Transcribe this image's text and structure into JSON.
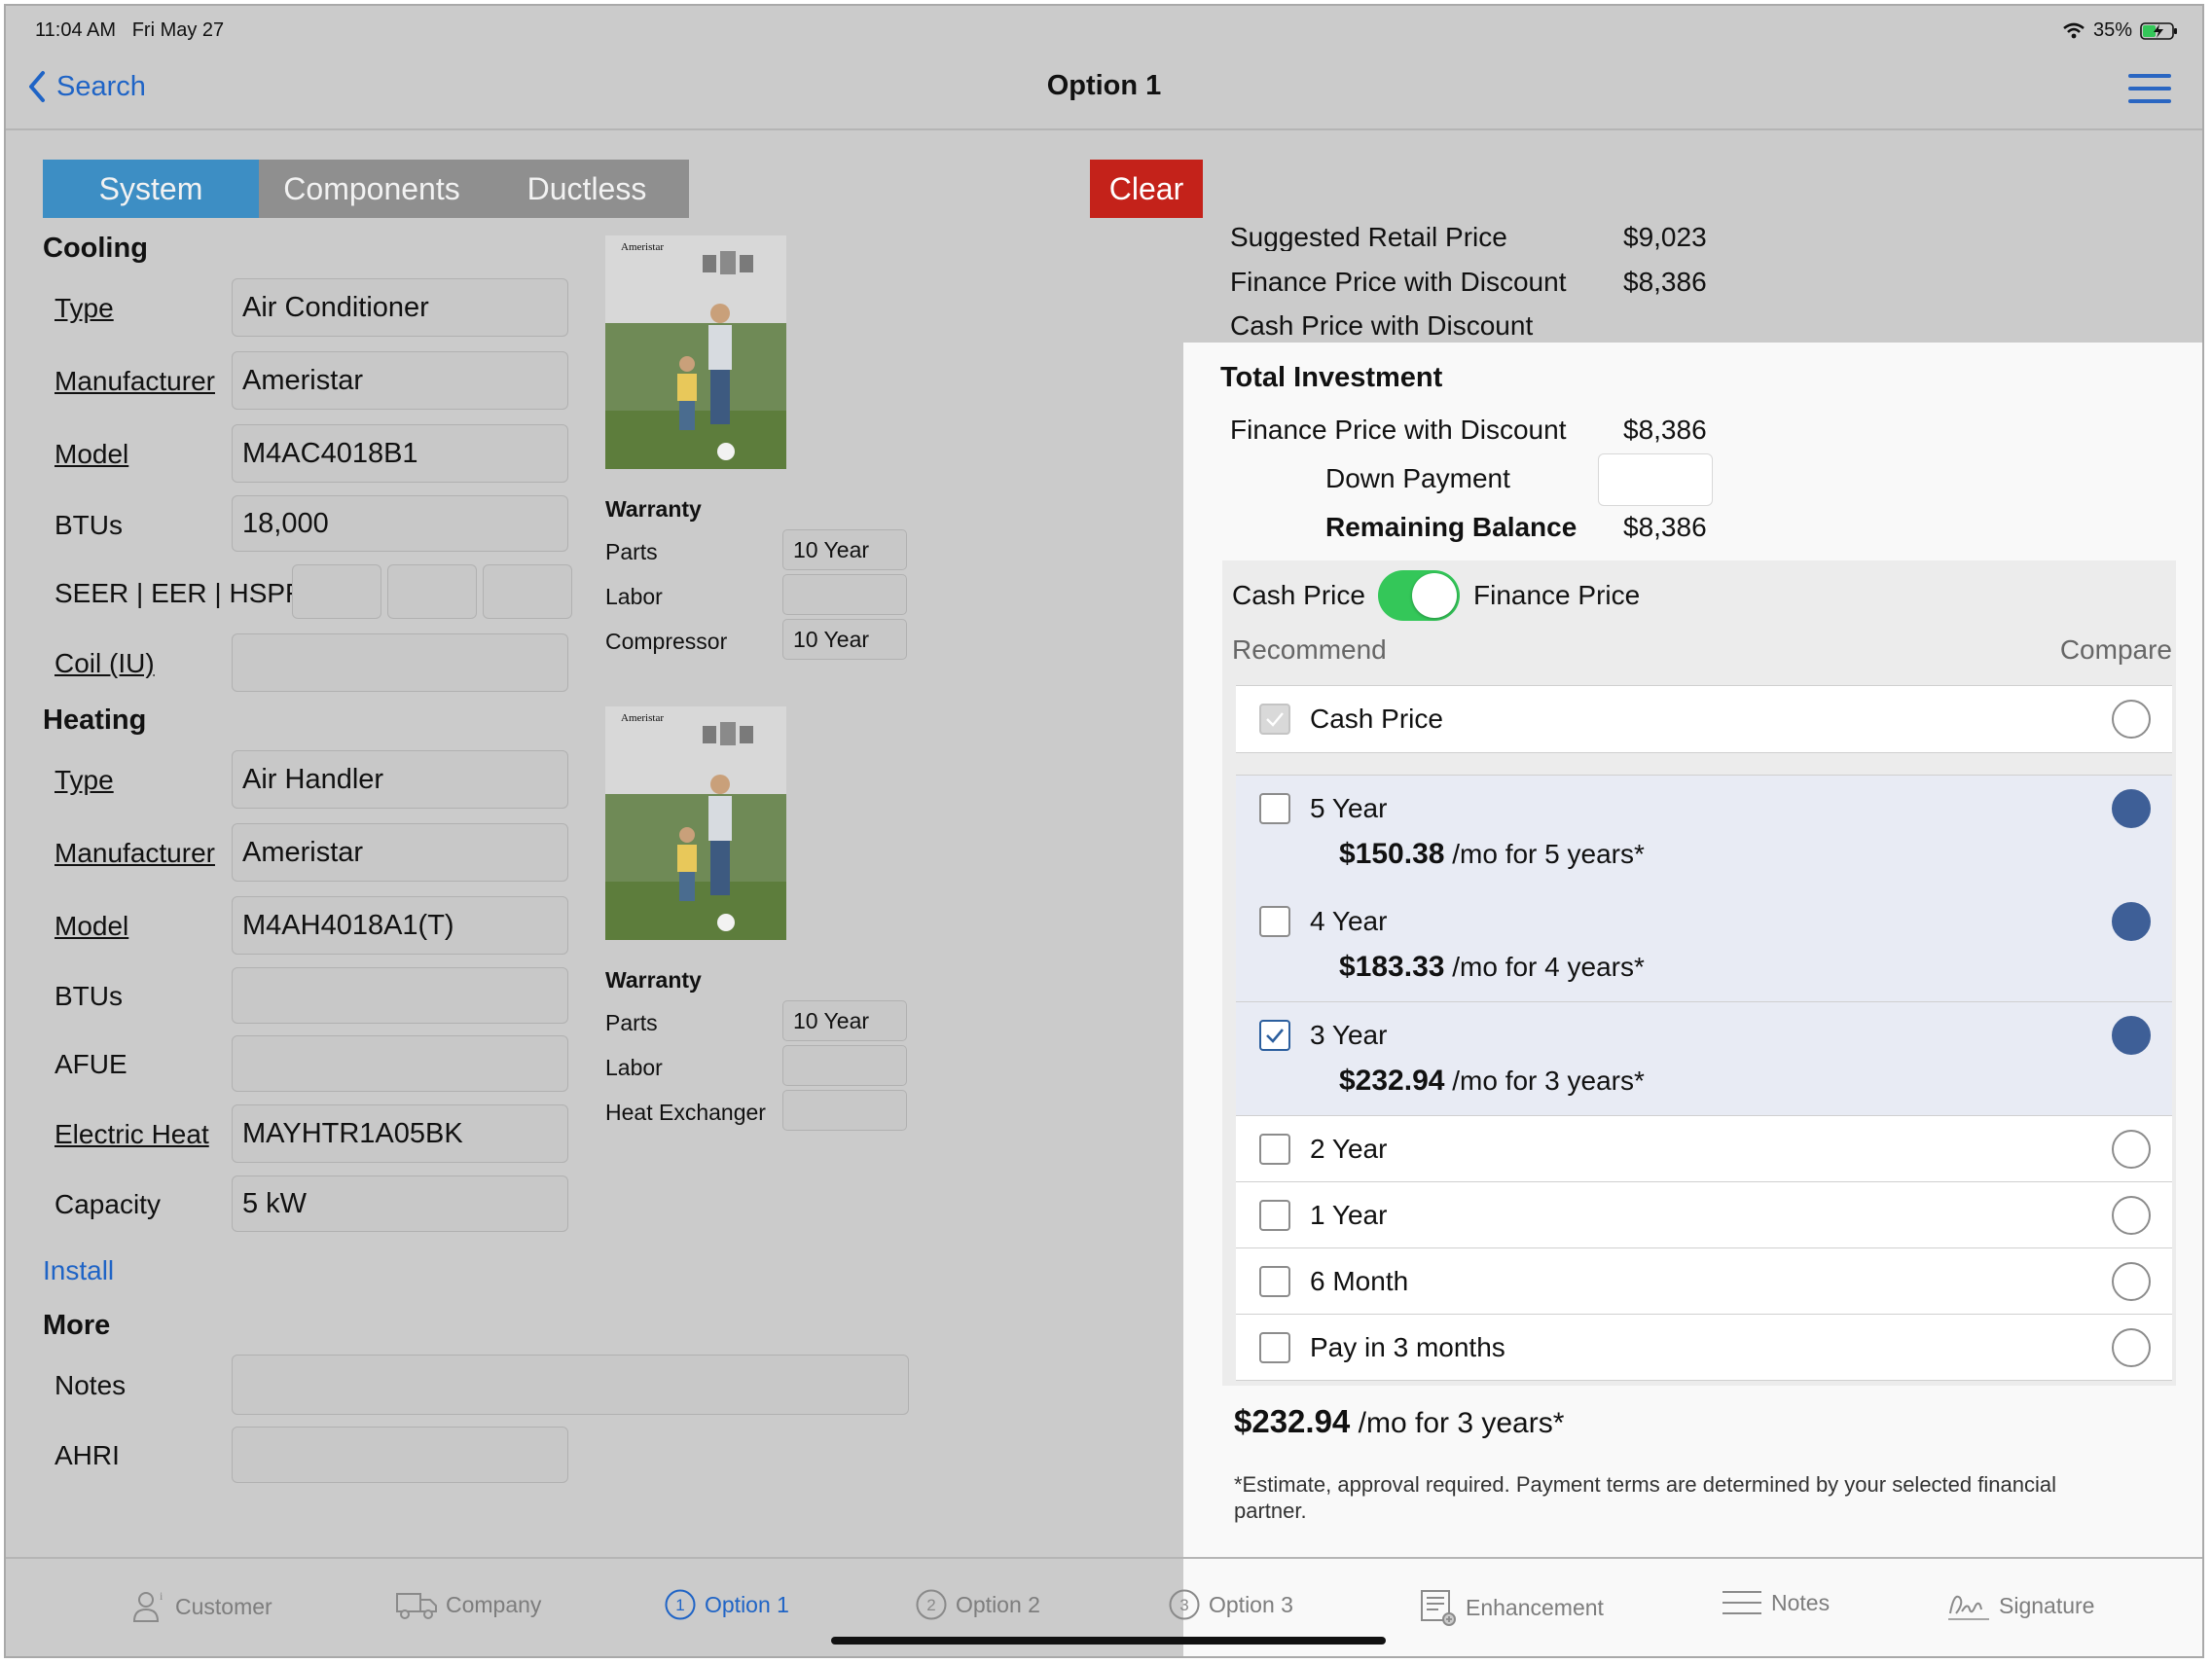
{
  "status_bar": {
    "time": "11:04 AM",
    "date": "Fri May 27",
    "battery": "35%"
  },
  "nav": {
    "back_label": "Search",
    "title": "Option 1"
  },
  "tabs": [
    "System",
    "Components",
    "Ductless"
  ],
  "clear_label": "Clear",
  "cooling": {
    "title": "Cooling",
    "type_label": "Type",
    "type_value": "Air Conditioner",
    "manufacturer_label": "Manufacturer",
    "manufacturer_value": "Ameristar",
    "model_label": "Model",
    "model_value": "M4AC4018B1",
    "btus_label": "BTUs",
    "btus_value": "18,000",
    "seer_label": "SEER | EER | HSPF",
    "coil_label": "Coil (IU)",
    "brochure_brand": "Ameristar",
    "warranty_title": "Warranty",
    "parts_label": "Parts",
    "parts_value": "10 Year",
    "labor_label": "Labor",
    "compressor_label": "Compressor",
    "compressor_value": "10 Year"
  },
  "heating": {
    "title": "Heating",
    "type_label": "Type",
    "type_value": "Air Handler",
    "manufacturer_label": "Manufacturer",
    "manufacturer_value": "Ameristar",
    "model_label": "Model",
    "model_value": "M4AH4018A1(T)",
    "btus_label": "BTUs",
    "afue_label": "AFUE",
    "electric_heat_label": "Electric Heat",
    "electric_heat_value": "MAYHTR1A05BK",
    "capacity_label": "Capacity",
    "capacity_value": "5 kW",
    "brochure_brand": "Ameristar",
    "warranty_title": "Warranty",
    "parts_label": "Parts",
    "parts_value": "10 Year",
    "labor_label": "Labor",
    "heat_exchanger_label": "Heat Exchanger"
  },
  "install_link": "Install",
  "more": {
    "title": "More",
    "notes_label": "Notes",
    "ahri_label": "AHRI"
  },
  "pricing_bg": {
    "suggested_label": "Suggested Retail Price",
    "suggested_value": "$9,023",
    "finance_label": "Finance Price with Discount",
    "finance_value": "$8,386",
    "cash_label": "Cash Price with Discount"
  },
  "investment": {
    "title": "Total Investment",
    "finance_label": "Finance Price with Discount",
    "finance_value": "$8,386",
    "down_label": "Down Payment",
    "down_value": "",
    "remaining_label": "Remaining Balance",
    "remaining_value": "$8,386"
  },
  "toggle": {
    "left_label": "Cash Price",
    "right_label": "Finance Price",
    "on": true
  },
  "recommend_label": "Recommend",
  "compare_label": "Compare",
  "options": [
    {
      "name": "Cash Price",
      "amount": "",
      "per": "",
      "recommend": "disabled",
      "compare": false
    },
    {
      "name": "5 Year",
      "amount": "$150.38",
      "per": "/mo for 5 years*",
      "recommend": "unchecked",
      "compare": true
    },
    {
      "name": "4 Year",
      "amount": "$183.33",
      "per": "/mo for 4 years*",
      "recommend": "unchecked",
      "compare": true
    },
    {
      "name": "3 Year",
      "amount": "$232.94",
      "per": "/mo for 3 years*",
      "recommend": "checked",
      "compare": true
    },
    {
      "name": "2 Year",
      "amount": "",
      "per": "",
      "recommend": "unchecked",
      "compare": false
    },
    {
      "name": "1 Year",
      "amount": "",
      "per": "",
      "recommend": "unchecked",
      "compare": false
    },
    {
      "name": "6 Month",
      "amount": "",
      "per": "",
      "recommend": "unchecked",
      "compare": false
    },
    {
      "name": "Pay in 3 months",
      "amount": "",
      "per": "",
      "recommend": "unchecked",
      "compare": false
    }
  ],
  "summary": {
    "amount": "$232.94",
    "per": "/mo for 3 years*"
  },
  "disclaimer": "*Estimate, approval required. Payment terms are determined by your selected financial partner.",
  "bottom_tabs": [
    {
      "label": "Customer",
      "icon": "customer-icon",
      "num": ""
    },
    {
      "label": "Company",
      "icon": "truck-icon",
      "num": ""
    },
    {
      "label": "Option 1",
      "icon": "circle-1-icon",
      "num": "1"
    },
    {
      "label": "Option 2",
      "icon": "circle-2-icon",
      "num": "2"
    },
    {
      "label": "Option 3",
      "icon": "circle-3-icon",
      "num": "3"
    },
    {
      "label": "Enhancement",
      "icon": "enhancement-icon",
      "num": ""
    },
    {
      "label": "Notes",
      "icon": "notes-icon",
      "num": ""
    },
    {
      "label": "Signature",
      "icon": "signature-icon",
      "num": ""
    }
  ],
  "colors": {
    "accent": "#1f64c6",
    "segment_active": "#3d8ec4",
    "clear": "#c4221a",
    "toggle_on": "#34c759",
    "compare_fill": "#3e5f97"
  }
}
